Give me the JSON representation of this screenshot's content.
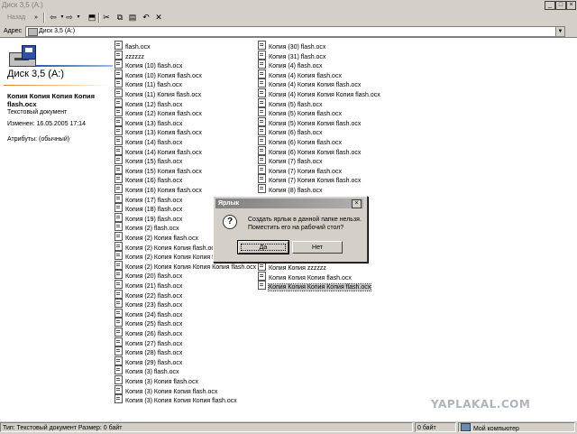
{
  "window": {
    "title": "Диск 3,5 (A:)"
  },
  "toolbar": {
    "back_label": "Назад",
    "chevron": "»"
  },
  "address": {
    "label": "Адрес",
    "value": "Диск 3,5 (A:)"
  },
  "left_pane": {
    "drive_title": "Диск 3,5 (A:)",
    "selected_name": "Копия Копия Копия Копия flash.ocx",
    "selected_type": "Текстовый документ",
    "modified": "Изменен: 16.05.2005 17:14",
    "attributes": "Атрибуты: (обычный)"
  },
  "files_col1": [
    "flash.ocx",
    "zzzzzz",
    "Копия (10) flash.ocx",
    "Копия (10) Копия flash.ocx",
    "Копия (11) flash.ocx",
    "Копия (11) Копия flash.ocx",
    "Копия (12) flash.ocx",
    "Копия (12) Копия flash.ocx",
    "Копия (13) flash.ocx",
    "Копия (13) Копия flash.ocx",
    "Копия (14) flash.ocx",
    "Копия (14) Копия flash.ocx",
    "Копия (15) flash.ocx",
    "Копия (15) Копия flash.ocx",
    "Копия (16) flash.ocx",
    "Копия (16) Копия flash.ocx",
    "Копия (17) flash.ocx",
    "Копия (18) flash.ocx",
    "Копия (19) flash.ocx",
    "Копия (2) flash.ocx",
    "Копия (2) Копия flash.ocx",
    "Копия (2) Копия Копия flash.ocx",
    "Копия (2) Копия Копия Копия flash.ocx",
    "Копия (2) Копия Копия Копия Копия flash.ocx",
    "Копия (20) flash.ocx",
    "Копия (21) flash.ocx",
    "Копия (22) flash.ocx",
    "Копия (23) flash.ocx",
    "Копия (24) flash.ocx",
    "Копия (25) flash.ocx",
    "Копия (26) flash.ocx",
    "Копия (27) flash.ocx",
    "Копия (28) flash.ocx",
    "Копия (29) flash.ocx",
    "Копия (3) flash.ocx",
    "Копия (3) Копия flash.ocx",
    "Копия (3) Копия Копия flash.ocx",
    "Копия (3) Копия Копия Копия flash.ocx"
  ],
  "files_col2_top": [
    "Копия (30) flash.ocx",
    "Копия (31) flash.ocx",
    "Копия (4) flash.ocx",
    "Копия (4) Копия flash.ocx",
    "Копия (4) Копия Копия flash.ocx",
    "Копия (4) Копия Копия Копия flash.ocx",
    "Копия (5) flash.ocx",
    "Копия (5) Копия flash.ocx",
    "Копия (5) Копия Копия flash.ocx",
    "Копия (6) flash.ocx",
    "Копия (6) Копия flash.ocx",
    "Копия (6) Копия Копия flash.ocx",
    "Копия (7) flash.ocx",
    "Копия (7) Копия flash.ocx",
    "Копия (7) Копия Копия flash.ocx",
    "Копия (8) flash.ocx"
  ],
  "files_col2_bottom": [
    "Копия Копия zzzzzz",
    "Копия Копия Копия flash.ocx",
    "Копия Копия Копия Копия flash.ocx"
  ],
  "dialog": {
    "title": "Ярлык",
    "message": "Создать ярлык в данной папке нельзя. Поместить его на рабочий стол?",
    "yes": "Да",
    "no": "Нет",
    "close": "×"
  },
  "status": {
    "info": "Тип: Текстовый документ Размер: 0 байт",
    "size": "0 байт",
    "zone": "Мой компьютер"
  },
  "watermark": "YAPLAKAL.COM"
}
